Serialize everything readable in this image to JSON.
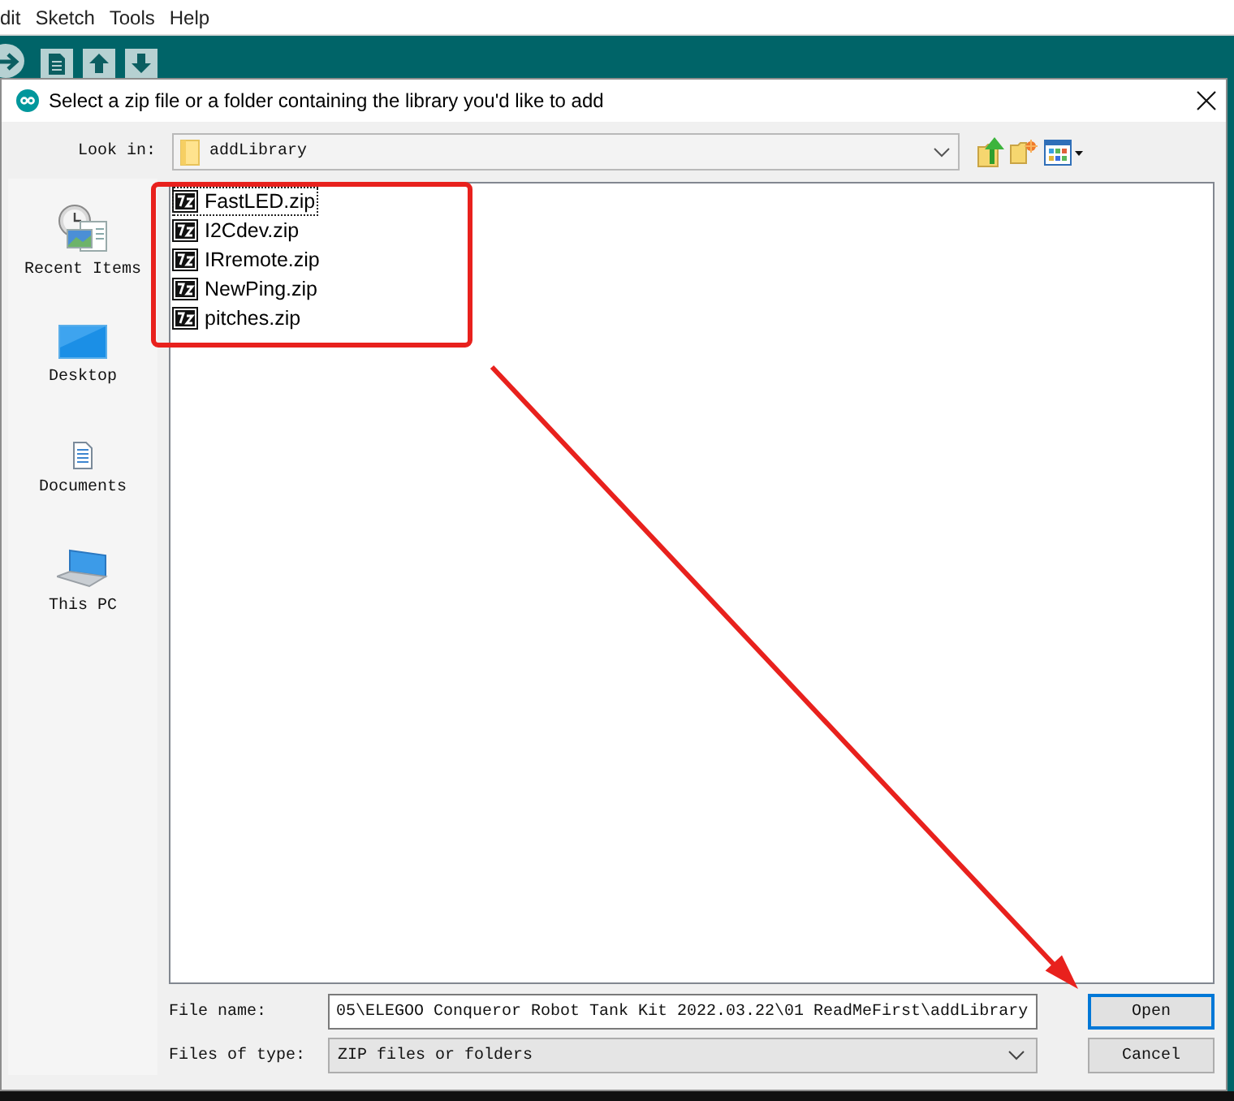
{
  "menu_bar": {
    "items": [
      "dit",
      "Sketch",
      "Tools",
      "Help"
    ]
  },
  "dialog": {
    "title": "Select a zip file or a folder containing the library you'd like to add",
    "look_in": {
      "label": "Look in:",
      "value": "addLibrary"
    },
    "places": [
      {
        "label": "Recent Items",
        "kind": "recent"
      },
      {
        "label": "Desktop",
        "kind": "desktop"
      },
      {
        "label": "Documents",
        "kind": "documents"
      },
      {
        "label": "This PC",
        "kind": "computer"
      }
    ],
    "files": [
      {
        "name": "FastLED.zip",
        "focused": true
      },
      {
        "name": "I2Cdev.zip",
        "focused": false
      },
      {
        "name": "IRremote.zip",
        "focused": false
      },
      {
        "name": "NewPing.zip",
        "focused": false
      },
      {
        "name": "pitches.zip",
        "focused": false
      }
    ],
    "file_name": {
      "label": "File name:",
      "value": "05\\ELEGOO Conqueror Robot Tank Kit 2022.03.22\\01 ReadMeFirst\\addLibrary"
    },
    "file_type": {
      "label": "Files of type:",
      "value": "ZIP files or folders"
    },
    "buttons": [
      {
        "label": "Open",
        "default": true
      },
      {
        "label": "Cancel",
        "default": false
      }
    ]
  }
}
